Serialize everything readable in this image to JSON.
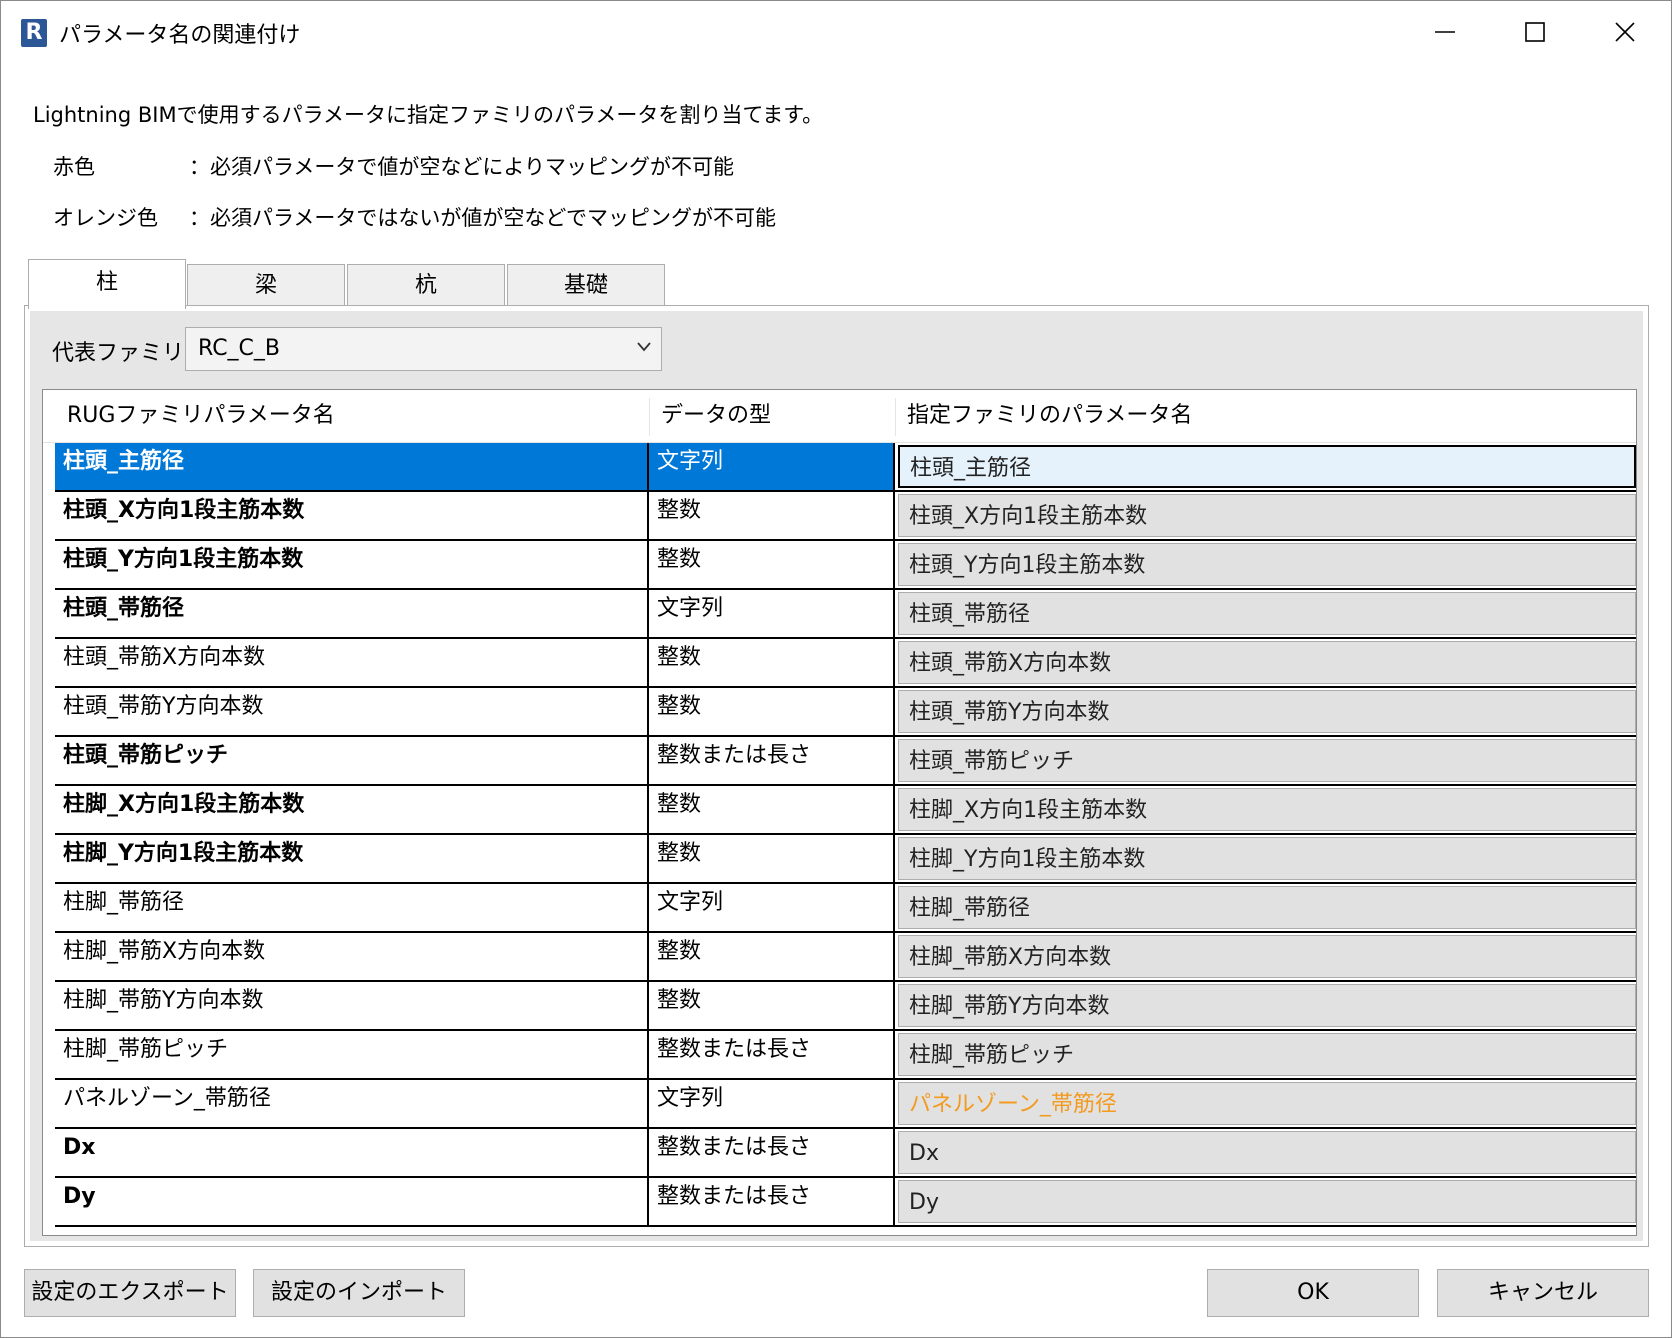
{
  "window": {
    "icon_letter": "R",
    "title": "パラメータ名の関連付け"
  },
  "description": "Lightning BIMで使用するパラメータに指定ファミリのパラメータを割り当てます。",
  "legend": [
    {
      "key": "赤色",
      "text": "：必須パラメータで値が空などによりマッピングが不可能"
    },
    {
      "key": "オレンジ色",
      "text": "：必須パラメータではないが値が空などでマッピングが不可能"
    }
  ],
  "tabs": [
    {
      "label": "柱",
      "active": true
    },
    {
      "label": "梁",
      "active": false
    },
    {
      "label": "杭",
      "active": false
    },
    {
      "label": "基礎",
      "active": false
    }
  ],
  "family": {
    "label": "代表ファミリ",
    "selected": "RC_C_B"
  },
  "grid": {
    "headers": [
      "RUGファミリパラメータ名",
      "データの型",
      "指定ファミリのパラメータ名"
    ],
    "rows": [
      {
        "name": "柱頭_主筋径",
        "type": "文字列",
        "mapped": "柱頭_主筋径",
        "bold": true,
        "selected": true,
        "status": "normal"
      },
      {
        "name": "柱頭_X方向1段主筋本数",
        "type": "整数",
        "mapped": "柱頭_X方向1段主筋本数",
        "bold": true,
        "selected": false,
        "status": "normal"
      },
      {
        "name": "柱頭_Y方向1段主筋本数",
        "type": "整数",
        "mapped": "柱頭_Y方向1段主筋本数",
        "bold": true,
        "selected": false,
        "status": "normal"
      },
      {
        "name": "柱頭_帯筋径",
        "type": "文字列",
        "mapped": "柱頭_帯筋径",
        "bold": true,
        "selected": false,
        "status": "normal"
      },
      {
        "name": "柱頭_帯筋X方向本数",
        "type": "整数",
        "mapped": "柱頭_帯筋X方向本数",
        "bold": false,
        "selected": false,
        "status": "normal"
      },
      {
        "name": "柱頭_帯筋Y方向本数",
        "type": "整数",
        "mapped": "柱頭_帯筋Y方向本数",
        "bold": false,
        "selected": false,
        "status": "normal"
      },
      {
        "name": "柱頭_帯筋ピッチ",
        "type": "整数または長さ",
        "mapped": "柱頭_帯筋ピッチ",
        "bold": true,
        "selected": false,
        "status": "normal"
      },
      {
        "name": "柱脚_X方向1段主筋本数",
        "type": "整数",
        "mapped": "柱脚_X方向1段主筋本数",
        "bold": true,
        "selected": false,
        "status": "normal"
      },
      {
        "name": "柱脚_Y方向1段主筋本数",
        "type": "整数",
        "mapped": "柱脚_Y方向1段主筋本数",
        "bold": true,
        "selected": false,
        "status": "normal"
      },
      {
        "name": "柱脚_帯筋径",
        "type": "文字列",
        "mapped": "柱脚_帯筋径",
        "bold": false,
        "selected": false,
        "status": "normal"
      },
      {
        "name": "柱脚_帯筋X方向本数",
        "type": "整数",
        "mapped": "柱脚_帯筋X方向本数",
        "bold": false,
        "selected": false,
        "status": "normal"
      },
      {
        "name": "柱脚_帯筋Y方向本数",
        "type": "整数",
        "mapped": "柱脚_帯筋Y方向本数",
        "bold": false,
        "selected": false,
        "status": "normal"
      },
      {
        "name": "柱脚_帯筋ピッチ",
        "type": "整数または長さ",
        "mapped": "柱脚_帯筋ピッチ",
        "bold": false,
        "selected": false,
        "status": "normal"
      },
      {
        "name": "パネルゾーン_帯筋径",
        "type": "文字列",
        "mapped": "パネルゾーン_帯筋径",
        "bold": false,
        "selected": false,
        "status": "orange"
      },
      {
        "name": "Dx",
        "type": "整数または長さ",
        "mapped": "Dx",
        "bold": true,
        "selected": false,
        "status": "normal"
      },
      {
        "name": "Dy",
        "type": "整数または長さ",
        "mapped": "Dy",
        "bold": true,
        "selected": false,
        "status": "normal"
      }
    ]
  },
  "buttons": {
    "export": "設定のエクスポート",
    "import": "設定のインポート",
    "ok": "OK",
    "cancel": "キャンセル"
  },
  "colors": {
    "selection": "#0078d7",
    "warning_orange": "#f39a1f"
  }
}
